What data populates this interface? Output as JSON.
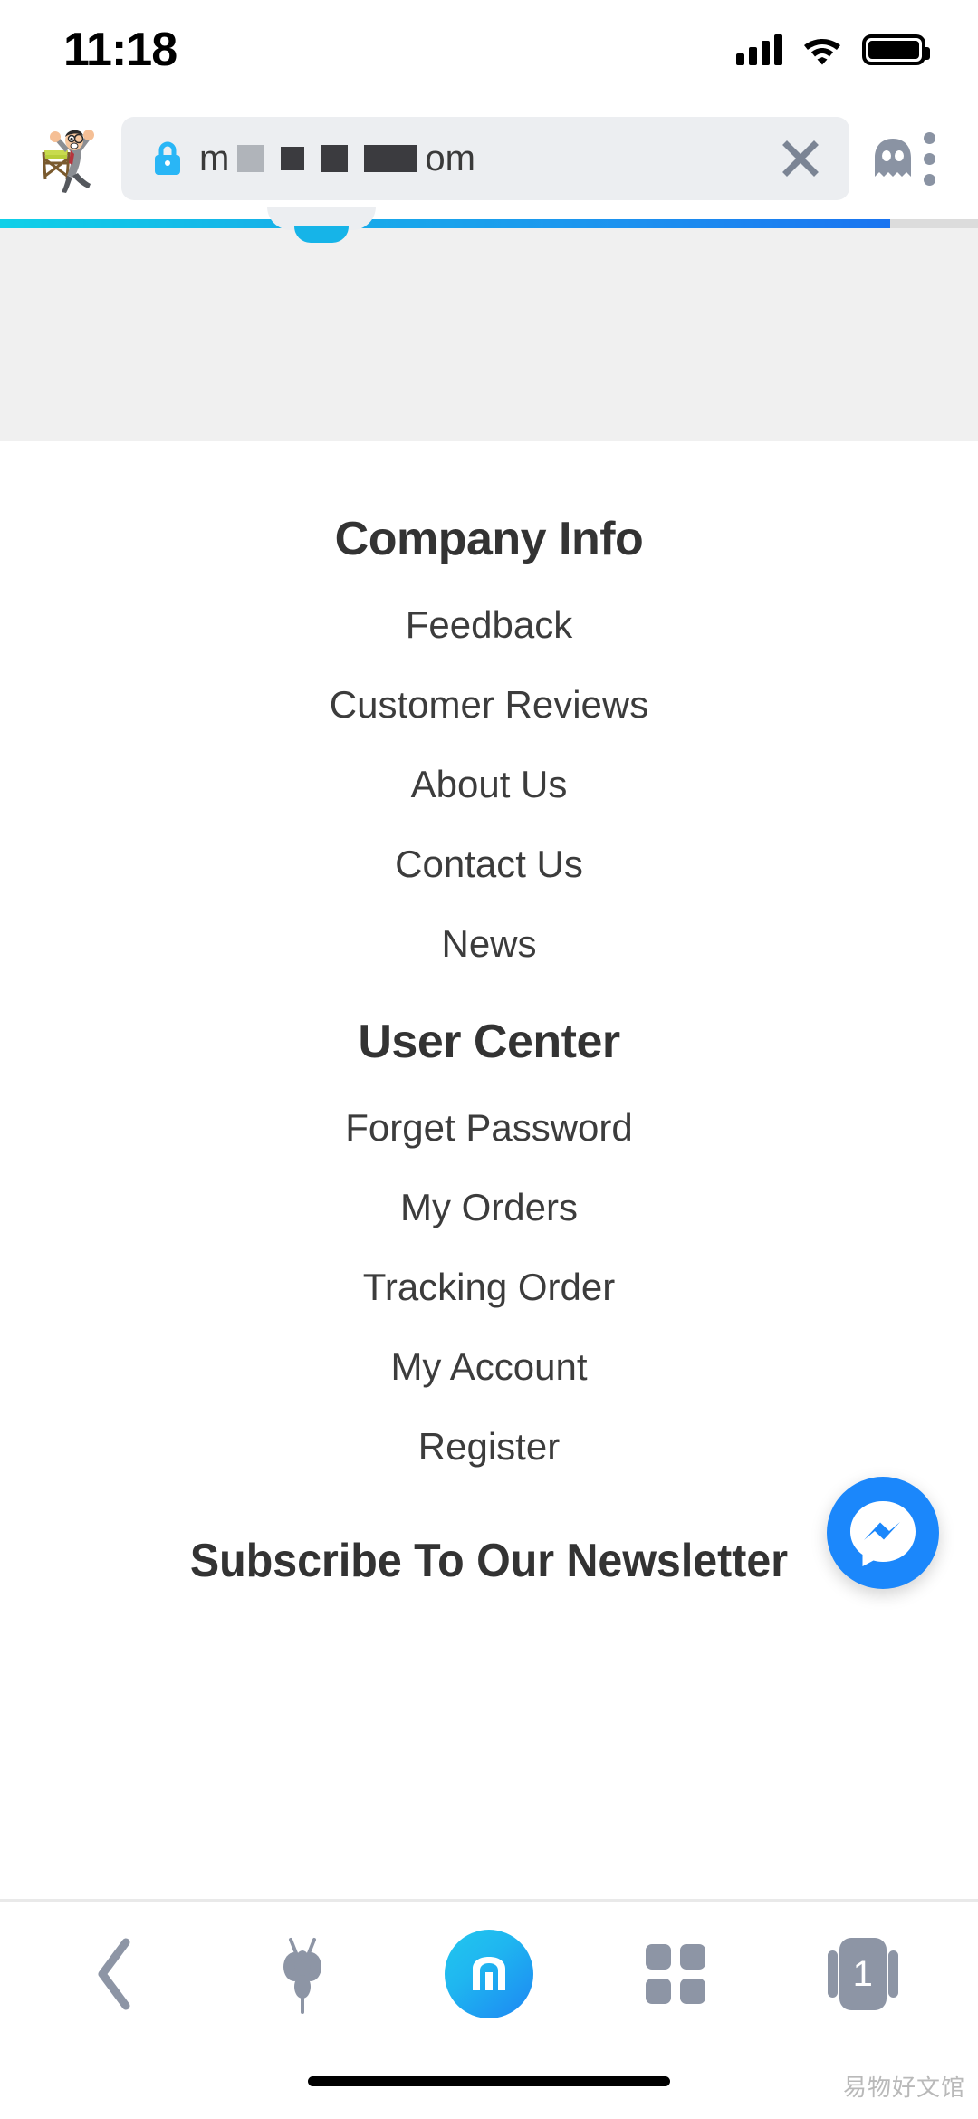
{
  "status_bar": {
    "time": "11:18",
    "signal_icon": "cellular-signal-icon",
    "wifi_icon": "wifi-icon",
    "battery_icon": "battery-full-icon"
  },
  "browser": {
    "favicon_name": "site-favicon-cartoon-man",
    "lock_icon": "lock-icon",
    "url_prefix": "m",
    "url_suffix": "om",
    "url_redacted": true,
    "clear_label": "close-icon",
    "ghost_icon": "ghost-incognito-icon",
    "menu_icon": "three-dots-menu-icon",
    "progress_percent": 91,
    "progress_color_start": "#0fd0e8",
    "progress_color_end": "#1a74f0"
  },
  "page_content": {
    "sections": [
      {
        "title": "Company Info",
        "links": [
          "Feedback",
          "Customer Reviews",
          "About Us",
          "Contact Us",
          "News"
        ]
      },
      {
        "title": "User Center",
        "links": [
          "Forget Password",
          "My Orders",
          "Tracking Order",
          "My Account",
          "Register"
        ]
      }
    ],
    "newsletter_title": "Subscribe To Our Newsletter",
    "messenger_fab": {
      "name": "facebook-messenger-button",
      "color": "#1b87fb"
    }
  },
  "bottom_nav": {
    "back_label": "back-chevron-icon",
    "gesture_label": "gesture-bug-icon",
    "home_label": "maxthon-logo-icon",
    "grid_label": "grid-apps-icon",
    "tabs_count": "1"
  },
  "watermark": "易物好文馆"
}
